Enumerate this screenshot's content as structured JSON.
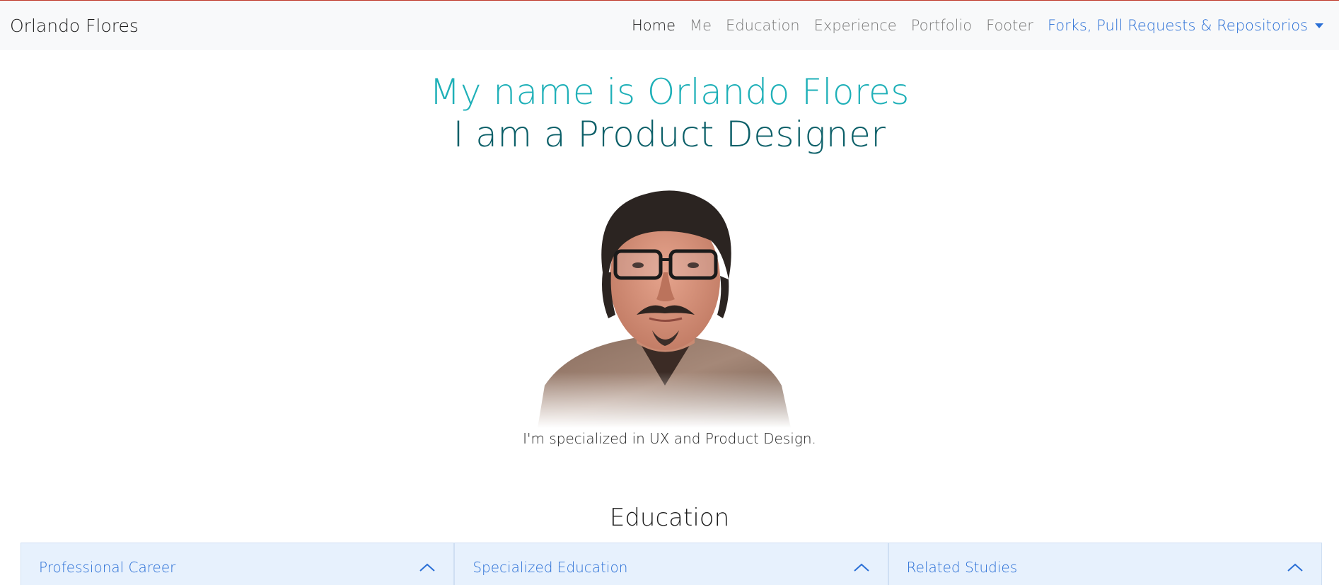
{
  "navbar": {
    "brand": "Orlando Flores",
    "links": [
      {
        "label": "Home",
        "active": true
      },
      {
        "label": "Me"
      },
      {
        "label": "Education"
      },
      {
        "label": "Experience"
      },
      {
        "label": "Portfolio"
      },
      {
        "label": "Footer"
      }
    ],
    "dropdown": "Forks, Pull Requests & Repositorios"
  },
  "hero": {
    "line1": "My name is Orlando Flores",
    "line2": "I am a Product Designer",
    "tagline": "I'm specialized in UX and Product Design."
  },
  "education": {
    "title": "Education",
    "panels": [
      {
        "label": "Professional Career"
      },
      {
        "label": "Specialized Education"
      },
      {
        "label": "Related Studies"
      }
    ]
  },
  "colors": {
    "accent_link": "#2a6fd6",
    "hero_line1": "#1fb0b8",
    "hero_line2": "#0b5f68",
    "accordion_bg": "#e7f1fd"
  },
  "icons": {
    "dropdown": "caret-down-icon",
    "accordion": "chevron-up-icon"
  }
}
